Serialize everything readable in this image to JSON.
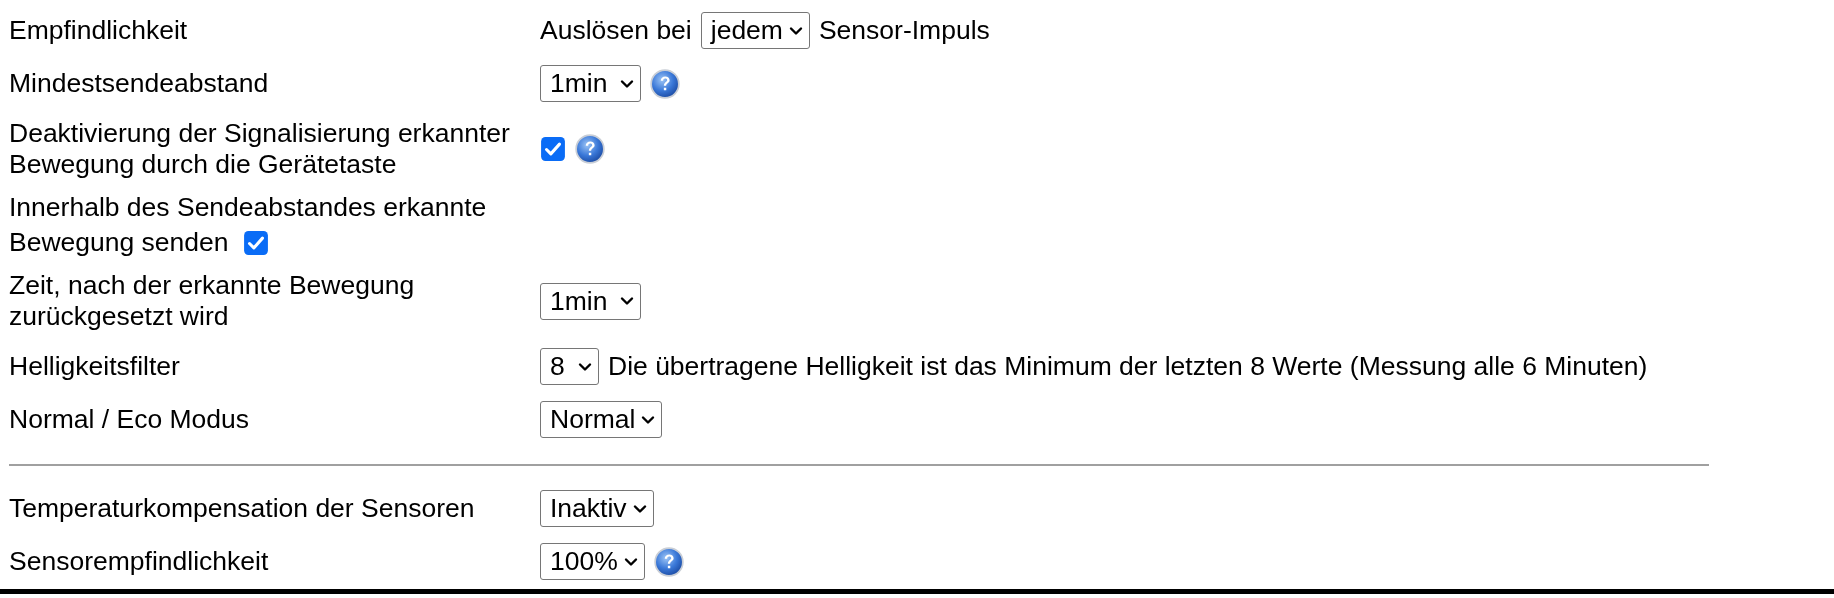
{
  "rows": [
    {
      "kind": "select",
      "label": "Empfindlichkeit",
      "prefix": "Auslösen bei",
      "value": "jedem",
      "suffix": "Sensor-Impuls",
      "help": false
    },
    {
      "kind": "select",
      "label": "Mindestsendeabstand",
      "value": "1min",
      "help": true
    },
    {
      "kind": "checkbox",
      "label": "Deaktivierung der Signalisierung erkannter Bewegung durch die Gerätetaste",
      "checked": true,
      "help": true
    },
    {
      "kind": "inline-checkbox",
      "label_lines": [
        "Innerhalb des Sendeabstandes erkannte",
        "Bewegung senden"
      ],
      "checked": true
    },
    {
      "kind": "select",
      "label": "Zeit, nach der erkannte Bewegung zurückgesetzt wird",
      "value": "1min",
      "help": false
    },
    {
      "kind": "select",
      "label": "Helligkeitsfilter",
      "value": "8",
      "suffix": "Die übertragene Helligkeit ist das Minimum der letzten 8 Werte (Messung alle 6 Minuten)",
      "help": false
    },
    {
      "kind": "select",
      "label": "Normal / Eco Modus",
      "value": "Normal",
      "help": false
    },
    {
      "kind": "divider"
    },
    {
      "kind": "select",
      "label": "Temperaturkompensation der Sensoren",
      "value": "Inaktiv",
      "help": false
    },
    {
      "kind": "select",
      "label": "Sensorempfindlichkeit",
      "value": "100%",
      "help": true
    }
  ]
}
